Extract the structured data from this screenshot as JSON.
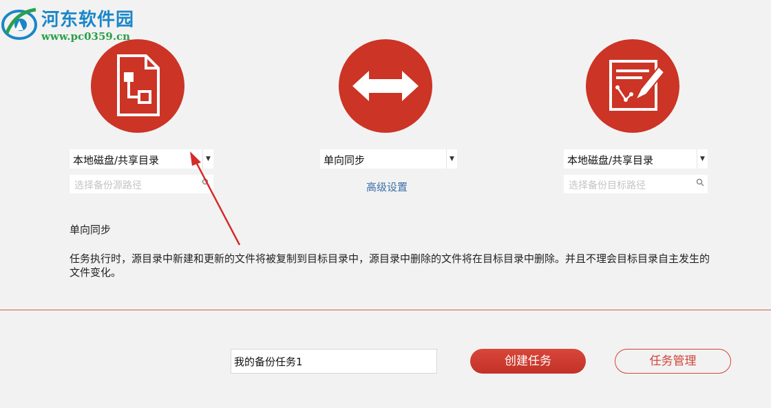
{
  "watermark": {
    "title": "河东软件园",
    "url": "www.pc0359.cn"
  },
  "source": {
    "icon": "file-diagram-icon",
    "location_type": "本地磁盘/共享目录",
    "path_placeholder": "选择备份源路径"
  },
  "sync": {
    "icon": "bidirectional-arrow-icon",
    "mode": "单向同步",
    "advanced_label": "高级设置"
  },
  "target": {
    "icon": "edit-document-icon",
    "location_type": "本地磁盘/共享目录",
    "path_placeholder": "选择备份目标路径"
  },
  "description": {
    "title": "单向同步",
    "body": "任务执行时，源目录中新建和更新的文件将被复制到目标目录中，源目录中删除的文件将在目标目录中删除。并且不理会目标目录自主发生的文件变化。"
  },
  "footer": {
    "task_name_value": "我的备份任务1",
    "create_label": "创建任务",
    "manage_label": "任务管理"
  },
  "colors": {
    "accent": "#cc3426",
    "link": "#3b6fa8",
    "background": "#f2f2f2"
  }
}
